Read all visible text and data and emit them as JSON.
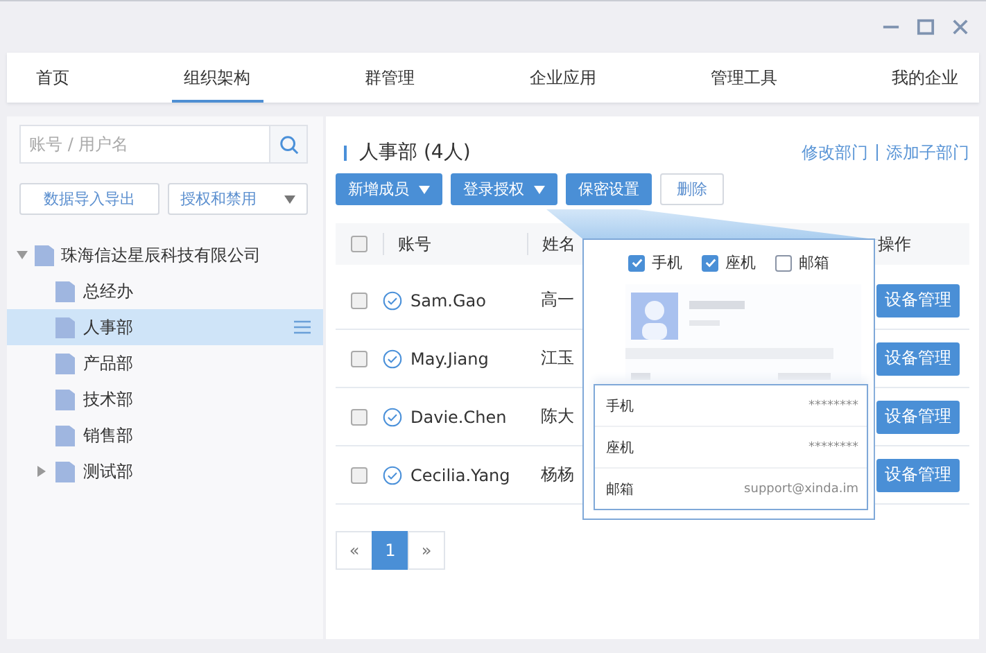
{
  "tabs": [
    {
      "label": "首页",
      "selected": false
    },
    {
      "label": "组织架构",
      "selected": true
    },
    {
      "label": "群管理",
      "selected": false
    },
    {
      "label": "企业应用",
      "selected": false
    },
    {
      "label": "管理工具",
      "selected": false
    },
    {
      "label": "我的企业",
      "selected": false
    }
  ],
  "sidebar": {
    "search": {
      "placeholder": "账号 / 用户名"
    },
    "buttons": [
      {
        "label": "数据导入导出",
        "dropdown": false
      },
      {
        "label": "授权和禁用",
        "dropdown": true
      }
    ],
    "tree": {
      "label": "珠海信达星辰科技有限公司",
      "expanded": true,
      "children": [
        {
          "label": "总经办",
          "selected": false,
          "expandable": false
        },
        {
          "label": "人事部",
          "selected": true,
          "expandable": false
        },
        {
          "label": "产品部",
          "selected": false,
          "expandable": false
        },
        {
          "label": "技术部",
          "selected": false,
          "expandable": false
        },
        {
          "label": "销售部",
          "selected": false,
          "expandable": false
        },
        {
          "label": "测试部",
          "selected": false,
          "expandable": true
        }
      ]
    }
  },
  "main": {
    "title": "人事部 (4人)",
    "links": [
      "修改部门",
      "添加子部门"
    ],
    "toolbar": [
      {
        "label": "新增成员",
        "kind": "primary",
        "dropdown": true
      },
      {
        "label": "登录授权",
        "kind": "primary",
        "dropdown": true
      },
      {
        "label": "保密设置",
        "kind": "primary",
        "dropdown": false
      },
      {
        "label": "删除",
        "kind": "plain",
        "dropdown": false
      }
    ],
    "table": {
      "columns": [
        "账号",
        "姓名",
        "操作"
      ],
      "all_checked": false,
      "rows": [
        {
          "checked": false,
          "account": "Sam.Gao",
          "name": "高一",
          "action": "设备管理"
        },
        {
          "checked": false,
          "account": "May.Jiang",
          "name": "江玉",
          "action": "设备管理"
        },
        {
          "checked": false,
          "account": "Davie.Chen",
          "name": "陈大",
          "action": "设备管理"
        },
        {
          "checked": false,
          "account": "Cecilia.Yang",
          "name": "杨杨",
          "action": "设备管理"
        }
      ]
    },
    "popover": {
      "options": [
        {
          "label": "手机",
          "checked": true
        },
        {
          "label": "座机",
          "checked": true
        },
        {
          "label": "邮箱",
          "checked": false
        }
      ],
      "fields": [
        {
          "label": "手机",
          "value": "********"
        },
        {
          "label": "座机",
          "value": "********"
        },
        {
          "label": "邮箱",
          "value": "support@xinda.im"
        }
      ]
    },
    "pagination": {
      "prev": "«",
      "pages": [
        {
          "label": "1",
          "selected": true
        }
      ],
      "next": "»"
    }
  }
}
